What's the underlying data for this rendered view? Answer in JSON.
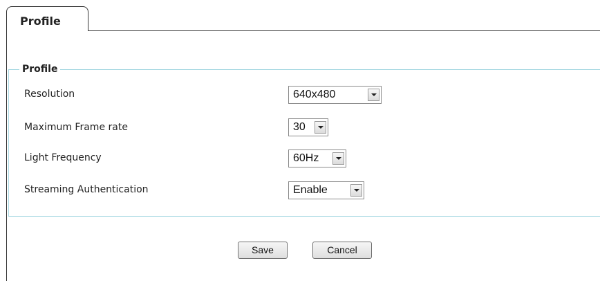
{
  "tabs": [
    {
      "label": "Profile",
      "active": true
    }
  ],
  "section": {
    "legend": "Profile",
    "rows": [
      {
        "label": "Resolution",
        "value": "640x480"
      },
      {
        "label": "Maximum Frame rate",
        "value": "30"
      },
      {
        "label": "Light Frequency",
        "value": "60Hz"
      },
      {
        "label": "Streaming Authentication",
        "value": "Enable"
      }
    ]
  },
  "actions": {
    "save_label": "Save",
    "cancel_label": "Cancel"
  },
  "colors": {
    "panel_border": "#a6d8e2",
    "tab_border": "#333333",
    "button_bg": "#e6e6e6"
  },
  "icons": {
    "dropdown": "chevron-down-icon"
  }
}
